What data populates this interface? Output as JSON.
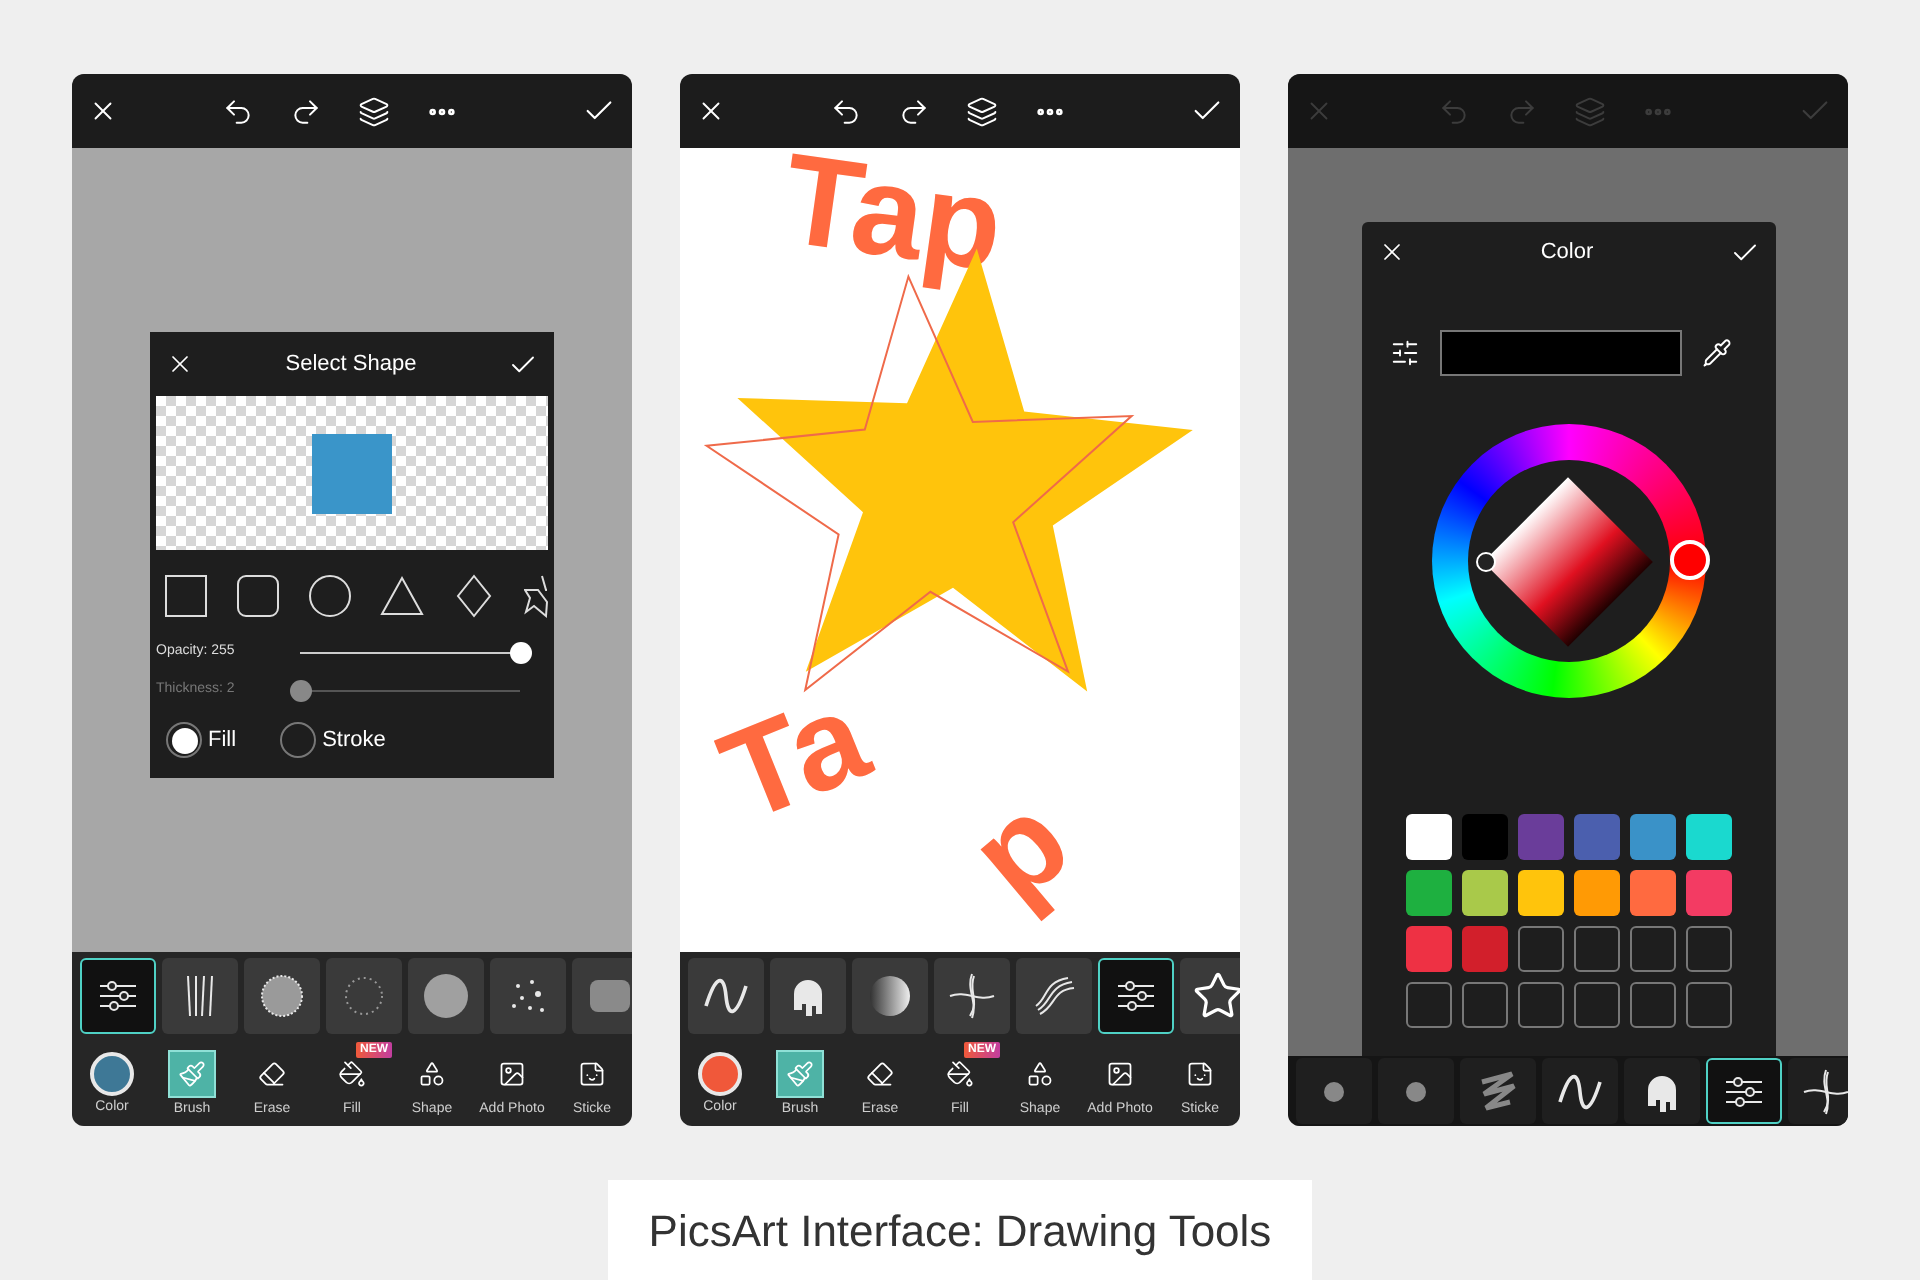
{
  "phones": [
    {
      "kind": "shape",
      "toolbar_disabled": false,
      "dialog": {
        "title": "Select Shape",
        "shapes": [
          {
            "kind": "square"
          },
          {
            "kind": "rounded"
          },
          {
            "kind": "circle"
          },
          {
            "kind": "triangle"
          },
          {
            "kind": "diamond"
          },
          {
            "kind": "star"
          }
        ],
        "sliders": [
          {
            "label": "Opacity: 255",
            "level": 1,
            "dim": false
          },
          {
            "label": "Thickness: 2",
            "level": 0,
            "dim": true
          }
        ],
        "options": [
          {
            "label": "Fill",
            "selected": true
          },
          {
            "label": "Stroke",
            "selected": false
          }
        ]
      },
      "brushes": [
        {
          "kind": "settings",
          "selected": true
        },
        {
          "kind": "lines",
          "selected": false
        },
        {
          "kind": "noise",
          "selected": false
        },
        {
          "kind": "spray",
          "selected": false
        },
        {
          "kind": "disc",
          "selected": false
        },
        {
          "kind": "dots",
          "selected": false
        },
        {
          "kind": "smudge",
          "selected": false
        }
      ],
      "tools": [
        {
          "kind": "color",
          "label": "Color",
          "color": "#3e7896"
        },
        {
          "kind": "brush",
          "label": "Brush",
          "selected": true
        },
        {
          "kind": "erase",
          "label": "Erase",
          "selected": false
        },
        {
          "kind": "fill",
          "label": "Fill",
          "badge": "NEW",
          "selected": false
        },
        {
          "kind": "shape",
          "label": "Shape",
          "selected": false
        },
        {
          "kind": "photo",
          "label": "Add Photo",
          "selected": false
        },
        {
          "kind": "sticker",
          "label": "Sticke",
          "selected": false
        }
      ]
    },
    {
      "kind": "canvas",
      "toolbar_disabled": false,
      "canvas_texts": [
        "Tap",
        "Ta",
        "p"
      ],
      "brushes": [
        {
          "kind": "wave",
          "selected": false
        },
        {
          "kind": "drip",
          "selected": false
        },
        {
          "kind": "sphere",
          "selected": false
        },
        {
          "kind": "cross",
          "selected": false
        },
        {
          "kind": "ribbon",
          "selected": false
        },
        {
          "kind": "settings",
          "selected": true
        },
        {
          "kind": "star",
          "selected": false
        }
      ],
      "tools": [
        {
          "kind": "color",
          "label": "Color",
          "color": "#f0583a"
        },
        {
          "kind": "brush",
          "label": "Brush",
          "selected": true
        },
        {
          "kind": "erase",
          "label": "Erase",
          "selected": false
        },
        {
          "kind": "fill",
          "label": "Fill",
          "badge": "NEW",
          "selected": false
        },
        {
          "kind": "shape",
          "label": "Shape",
          "selected": false
        },
        {
          "kind": "photo",
          "label": "Add Photo",
          "selected": false
        },
        {
          "kind": "sticker",
          "label": "Sticke",
          "selected": false
        }
      ]
    },
    {
      "kind": "color",
      "toolbar_disabled": true,
      "dialog": {
        "title": "Color",
        "swatches": [
          {
            "color": "#ffffff"
          },
          {
            "color": "#000000"
          },
          {
            "color": "#6a3d9a"
          },
          {
            "color": "#4b5fae"
          },
          {
            "color": "#3a92c8"
          },
          {
            "color": "#1ad9cf"
          },
          {
            "color": "#1eb040"
          },
          {
            "color": "#a9c94a"
          },
          {
            "color": "#ffc40c"
          },
          {
            "color": "#ff9a05"
          },
          {
            "color": "#ff6a40"
          },
          {
            "color": "#f33b63"
          },
          {
            "color": "#ee3144"
          },
          {
            "color": "#d21f2b"
          },
          {
            "kind": "empty"
          },
          {
            "kind": "empty"
          },
          {
            "kind": "empty"
          },
          {
            "kind": "empty"
          },
          {
            "kind": "empty"
          },
          {
            "kind": "empty"
          },
          {
            "kind": "empty"
          },
          {
            "kind": "empty"
          },
          {
            "kind": "empty"
          },
          {
            "kind": "empty"
          }
        ]
      },
      "brushes": [
        {
          "kind": "dot",
          "selected": false
        },
        {
          "kind": "dot",
          "selected": false
        },
        {
          "kind": "scribble",
          "selected": false
        },
        {
          "kind": "wave",
          "selected": false
        },
        {
          "kind": "drip",
          "selected": false
        },
        {
          "kind": "settings",
          "selected": true
        },
        {
          "kind": "cross",
          "selected": false
        }
      ]
    }
  ],
  "caption": "PicsArt Interface: Drawing Tools"
}
